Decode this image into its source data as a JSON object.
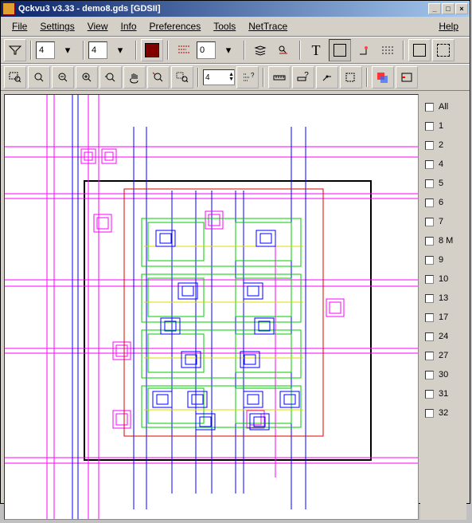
{
  "titlebar": {
    "title": "Qckvu3 v3.33 - demo8.gds [GDSII]"
  },
  "menu": {
    "file": "File",
    "settings": "Settings",
    "view": "View",
    "info": "Info",
    "preferences": "Preferences",
    "tools": "Tools",
    "nettrace": "NetTrace",
    "help": "Help"
  },
  "toolbar1": {
    "num1": "4",
    "num2": "4",
    "num3": "0",
    "text_label": "T"
  },
  "toolbar2": {
    "nesting": "4",
    "ruler_q": "?"
  },
  "layers": {
    "all": "All",
    "items": [
      {
        "label": "1"
      },
      {
        "label": "2"
      },
      {
        "label": "4"
      },
      {
        "label": "5"
      },
      {
        "label": "6"
      },
      {
        "label": "7"
      },
      {
        "label": "8 M"
      },
      {
        "label": "9"
      },
      {
        "label": "10"
      },
      {
        "label": "13"
      },
      {
        "label": "17"
      },
      {
        "label": "24"
      },
      {
        "label": "27"
      },
      {
        "label": "30"
      },
      {
        "label": "31"
      },
      {
        "label": "32"
      }
    ]
  }
}
